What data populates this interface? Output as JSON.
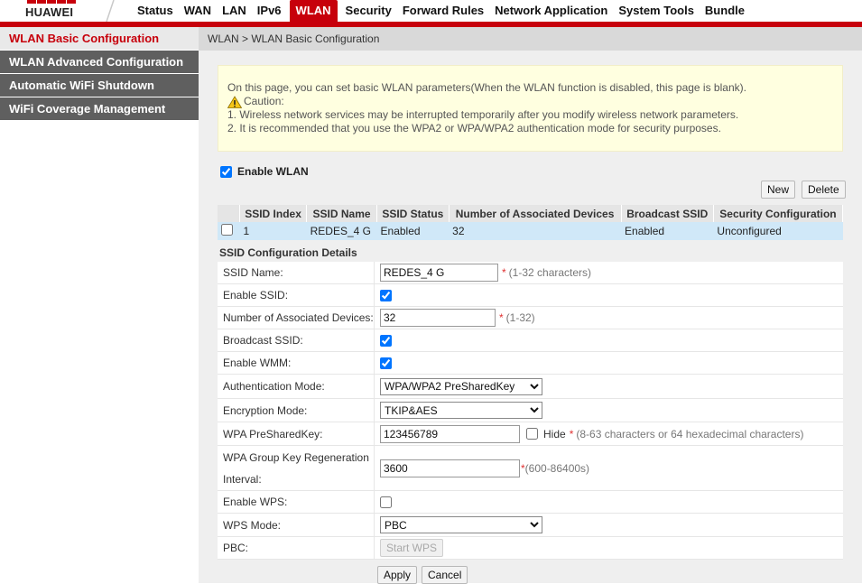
{
  "brand": {
    "name": "HUAWEI"
  },
  "nav": {
    "tabs": [
      "Status",
      "WAN",
      "LAN",
      "IPv6",
      "WLAN",
      "Security",
      "Forward Rules",
      "Network Application",
      "System Tools",
      "Bundle"
    ],
    "active": "WLAN"
  },
  "sidebar": {
    "items": [
      "WLAN Basic Configuration",
      "WLAN Advanced Configuration",
      "Automatic WiFi Shutdown",
      "WiFi Coverage Management"
    ]
  },
  "breadcrumb": "WLAN > WLAN Basic Configuration",
  "notice": {
    "intro": "On this page, you can set basic WLAN parameters(When the WLAN function is disabled, this page is blank).",
    "caution": "Caution:",
    "line1": "1. Wireless network services may be interrupted temporarily after you modify wireless network parameters.",
    "line2": "2. It is recommended that you use the WPA2 or WPA/WPA2 authentication mode for security purposes."
  },
  "enable_wlan": {
    "label": "Enable WLAN",
    "checked": true
  },
  "buttons": {
    "new": "New",
    "delete": "Delete",
    "apply": "Apply",
    "cancel": "Cancel",
    "start_wps": "Start WPS"
  },
  "ssid_table": {
    "headers": [
      "SSID Index",
      "SSID Name",
      "SSID Status",
      "Number of Associated Devices",
      "Broadcast SSID",
      "Security Configuration"
    ],
    "rows": [
      {
        "index": "1",
        "name": "REDES_4 G",
        "status": "Enabled",
        "devices": "32",
        "broadcast": "Enabled",
        "security": "Unconfigured"
      }
    ]
  },
  "details": {
    "title": "SSID Configuration Details",
    "ssid_name": {
      "label": "SSID Name:",
      "value": "REDES_4 G",
      "hint": "(1-32 characters)"
    },
    "enable_ssid": {
      "label": "Enable SSID:",
      "checked": true
    },
    "assoc_devices": {
      "label": "Number of Associated Devices:",
      "value": "32",
      "hint": "(1-32)"
    },
    "broadcast_ssid": {
      "label": "Broadcast SSID:",
      "checked": true
    },
    "enable_wmm": {
      "label": "Enable WMM:",
      "checked": true
    },
    "auth_mode": {
      "label": "Authentication Mode:",
      "value": "WPA/WPA2 PreSharedKey"
    },
    "encryption_mode": {
      "label": "Encryption Mode:",
      "value": "TKIP&AES"
    },
    "psk": {
      "label": "WPA PreSharedKey:",
      "value": "123456789",
      "hide_label": "Hide",
      "hint": "(8-63 characters or 64 hexadecimal characters)"
    },
    "group_key": {
      "label_line1": "WPA Group Key Regeneration",
      "label_line2": "Interval:",
      "value": "3600",
      "hint": "(600-86400s)"
    },
    "enable_wps": {
      "label": "Enable WPS:",
      "checked": false
    },
    "wps_mode": {
      "label": "WPS Mode:",
      "value": "PBC"
    },
    "pbc": {
      "label": "PBC:"
    }
  },
  "colors": {
    "accent": "#c7000b",
    "sidebar_dark": "#5f5f5f",
    "notice_bg": "#ffffe0",
    "row_selected": "#d0e8f8"
  }
}
